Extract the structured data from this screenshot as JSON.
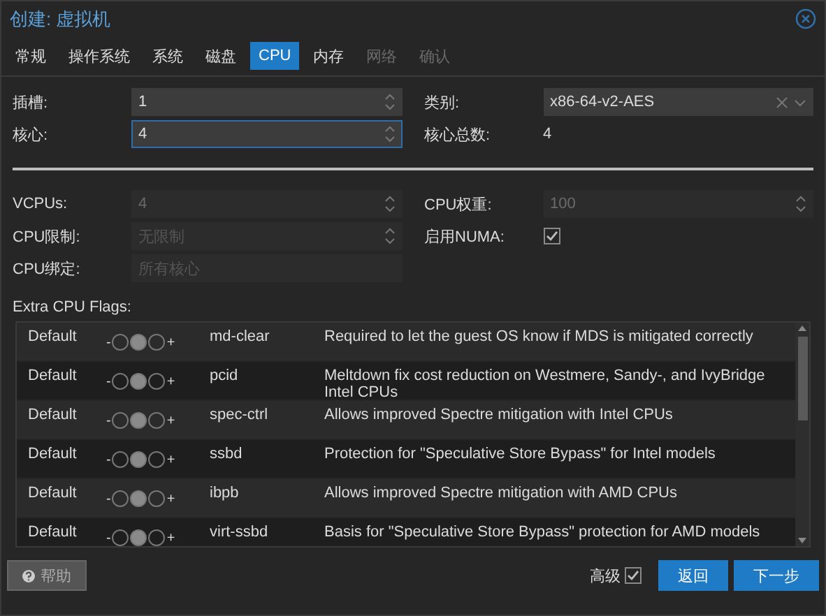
{
  "window": {
    "title": "创建: 虚拟机"
  },
  "tabs": [
    {
      "label": "常规",
      "selected": false,
      "disabled": false
    },
    {
      "label": "操作系统",
      "selected": false,
      "disabled": false
    },
    {
      "label": "系统",
      "selected": false,
      "disabled": false
    },
    {
      "label": "磁盘",
      "selected": false,
      "disabled": false
    },
    {
      "label": "CPU",
      "selected": true,
      "disabled": false
    },
    {
      "label": "内存",
      "selected": false,
      "disabled": false
    },
    {
      "label": "网络",
      "selected": false,
      "disabled": true
    },
    {
      "label": "确认",
      "selected": false,
      "disabled": true
    }
  ],
  "basic": {
    "left": [
      {
        "label": "插槽:",
        "kind": "spinner",
        "value": "1",
        "disabled": false,
        "focused": false
      },
      {
        "label": "核心:",
        "kind": "spinner",
        "value": "4",
        "disabled": false,
        "focused": true
      }
    ],
    "right": [
      {
        "label": "类别:",
        "kind": "combo",
        "value": "x86-64-v2-AES",
        "disabled": false,
        "focused": false
      },
      {
        "label": "核心总数:",
        "kind": "display",
        "value": "4"
      }
    ]
  },
  "advanced": {
    "left": [
      {
        "label": "VCPUs:",
        "kind": "spinner",
        "value": "4",
        "disabled": true
      },
      {
        "label": "CPU限制:",
        "kind": "spinner",
        "placeholder": "无限制",
        "disabled": true
      },
      {
        "label": "CPU绑定:",
        "kind": "text",
        "placeholder": "所有核心",
        "disabled": true
      }
    ],
    "right": [
      {
        "label": "CPU权重:",
        "kind": "spinner",
        "value": "100",
        "disabled": true
      },
      {
        "label": "启用NUMA:",
        "kind": "checkbox",
        "checked": true
      }
    ]
  },
  "flags": {
    "label": "Extra CPU Flags:",
    "rows": [
      {
        "state": "Default",
        "minus": "-",
        "plus": "+",
        "toggle": [
          {
            "selected": false
          },
          {
            "selected": true
          },
          {
            "selected": false
          }
        ],
        "flag": "md-clear",
        "description": "Required to let the guest OS know if MDS is mitigated correctly"
      },
      {
        "state": "Default",
        "minus": "-",
        "plus": "+",
        "toggle": [
          {
            "selected": false
          },
          {
            "selected": true
          },
          {
            "selected": false
          }
        ],
        "flag": "pcid",
        "description": "Meltdown fix cost reduction on Westmere, Sandy-, and IvyBridge Intel CPUs"
      },
      {
        "state": "Default",
        "minus": "-",
        "plus": "+",
        "toggle": [
          {
            "selected": false
          },
          {
            "selected": true
          },
          {
            "selected": false
          }
        ],
        "flag": "spec-ctrl",
        "description": "Allows improved Spectre mitigation with Intel CPUs"
      },
      {
        "state": "Default",
        "minus": "-",
        "plus": "+",
        "toggle": [
          {
            "selected": false
          },
          {
            "selected": true
          },
          {
            "selected": false
          }
        ],
        "flag": "ssbd",
        "description": "Protection for \"Speculative Store Bypass\" for Intel models"
      },
      {
        "state": "Default",
        "minus": "-",
        "plus": "+",
        "toggle": [
          {
            "selected": false
          },
          {
            "selected": true
          },
          {
            "selected": false
          }
        ],
        "flag": "ibpb",
        "description": "Allows improved Spectre mitigation with AMD CPUs"
      },
      {
        "state": "Default",
        "minus": "-",
        "plus": "+",
        "toggle": [
          {
            "selected": false
          },
          {
            "selected": true
          },
          {
            "selected": false
          }
        ],
        "flag": "virt-ssbd",
        "description": "Basis for \"Speculative Store Bypass\" protection for AMD models"
      }
    ]
  },
  "footer": {
    "help": "帮助",
    "advanced": {
      "label": "高级",
      "checked": true
    },
    "buttons": [
      "返回",
      "下一步"
    ]
  }
}
